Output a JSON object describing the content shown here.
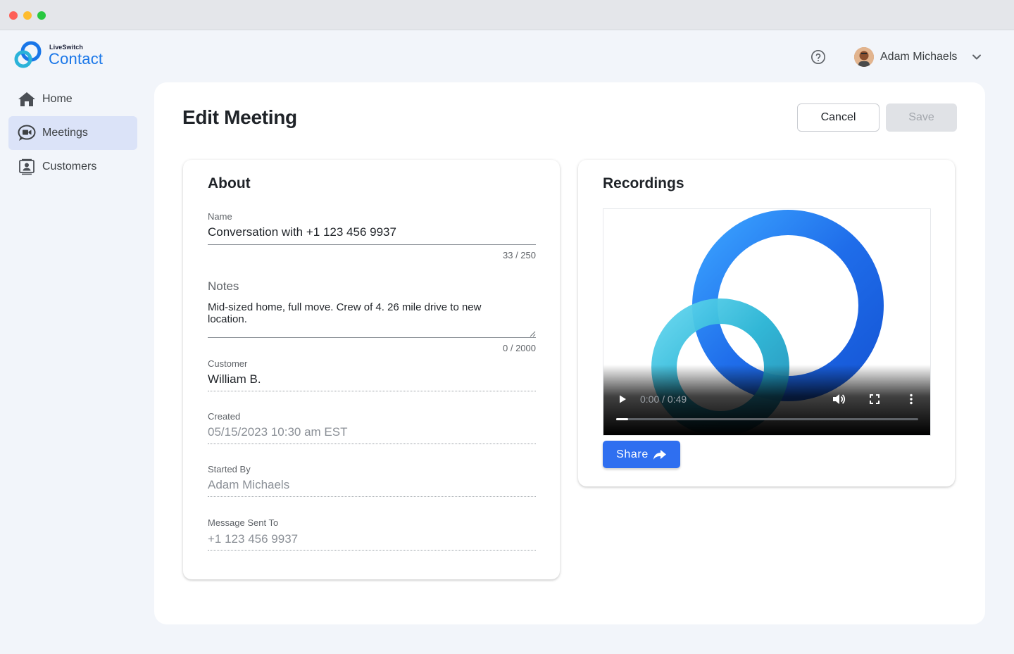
{
  "app": {
    "brand_small": "LiveSwitch",
    "brand_large": "Contact",
    "colors": {
      "accent": "#2f6ff0",
      "brand": "#1976e8",
      "nav_active": "#dbe3f8"
    }
  },
  "header": {
    "user_name": "Adam Michaels",
    "help_icon": "help-circle-icon"
  },
  "sidebar": {
    "items": [
      {
        "label": "Home",
        "icon": "home-icon",
        "active": false
      },
      {
        "label": "Meetings",
        "icon": "meetings-icon",
        "active": true
      },
      {
        "label": "Customers",
        "icon": "customers-icon",
        "active": false
      }
    ]
  },
  "page": {
    "title": "Edit Meeting",
    "cancel_label": "Cancel",
    "save_label": "Save"
  },
  "about": {
    "title": "About",
    "name_label": "Name",
    "name_value": "Conversation with  +1 123 456 9937",
    "name_counter": "33 / 250",
    "notes_label": "Notes",
    "notes_value": "Mid-sized home, full move. Crew of 4. 26 mile drive to new location.",
    "notes_counter": "0 / 2000",
    "customer_label": "Customer",
    "customer_value": "William B.",
    "created_label": "Created",
    "created_value": "05/15/2023 10:30 am EST",
    "started_by_label": "Started By",
    "started_by_value": "Adam Michaels",
    "message_sent_label": "Message Sent To",
    "message_sent_value": "+1 123 456 9937"
  },
  "recordings": {
    "title": "Recordings",
    "time": "0:00 / 0:49",
    "progress": 0.04,
    "share_label": "Share"
  }
}
